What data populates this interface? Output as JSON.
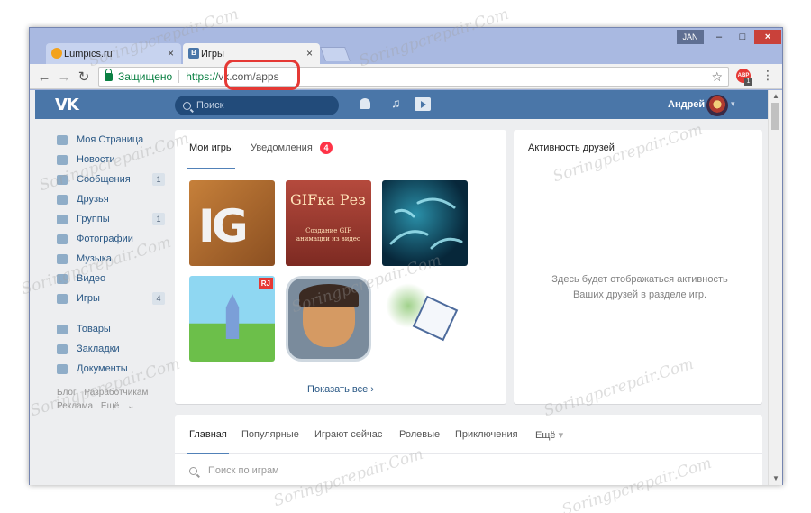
{
  "browser": {
    "tabs": [
      {
        "title": "Lumpics.ru",
        "active": false,
        "favicon": "orange-circle"
      },
      {
        "title": "Игры",
        "active": true,
        "favicon": "vk-logo"
      }
    ],
    "window_badge": "JAN",
    "address_bar": {
      "secure_label": "Защищено",
      "url_scheme": "https://",
      "url_host": "vk",
      "url_path": ".com/apps"
    },
    "adblock_count": "1"
  },
  "vk": {
    "logo": "VK",
    "search_placeholder": "Поиск",
    "user_name": "Андрей",
    "left_menu": [
      {
        "label": "Моя Страница",
        "icon": "home-icon"
      },
      {
        "label": "Новости",
        "icon": "news-icon"
      },
      {
        "label": "Сообщения",
        "icon": "messages-icon",
        "badge": "1"
      },
      {
        "label": "Друзья",
        "icon": "friends-icon"
      },
      {
        "label": "Группы",
        "icon": "groups-icon",
        "badge": "1"
      },
      {
        "label": "Фотографии",
        "icon": "camera-icon"
      },
      {
        "label": "Музыка",
        "icon": "music-icon"
      },
      {
        "label": "Видео",
        "icon": "video-icon"
      },
      {
        "label": "Игры",
        "icon": "gamepad-icon",
        "badge": "4"
      }
    ],
    "left_menu_extra": [
      {
        "label": "Товары",
        "icon": "bag-icon"
      },
      {
        "label": "Закладки",
        "icon": "star-icon"
      },
      {
        "label": "Документы",
        "icon": "document-icon"
      }
    ],
    "footer_links": [
      "Блог",
      "Разработчикам",
      "Реклама",
      "Ещё"
    ],
    "games_panel": {
      "tab_my_games": "Мои игры",
      "tab_notifications": "Уведомления",
      "notifications_count": "4",
      "game_tiles": [
        {
          "name": "ig-game",
          "text": "IG"
        },
        {
          "name": "gifka-rez",
          "title": "GIFка Рез",
          "subtitle": "Создание GIF анимации из видео"
        },
        {
          "name": "bacteria-game"
        },
        {
          "name": "castle-game",
          "badge": "RJ"
        },
        {
          "name": "hero-game"
        },
        {
          "name": "dice-game"
        }
      ],
      "show_all": "Показать все"
    },
    "friends_activity": {
      "title": "Активность друзей",
      "empty_text_line1": "Здесь будет отображаться активность",
      "empty_text_line2": "Ваших друзей в разделе игр."
    },
    "catalog": {
      "tabs": [
        "Главная",
        "Популярные",
        "Играют сейчас",
        "Ролевые",
        "Приключения",
        "Ещё"
      ],
      "search_placeholder": "Поиск по играм"
    }
  },
  "colors": {
    "vk_blue": "#4a76a8",
    "link": "#2a5885",
    "notification_red": "#ff3347",
    "url_highlight": "#e53935"
  },
  "watermark_text": "Soringpcrepair.Com"
}
